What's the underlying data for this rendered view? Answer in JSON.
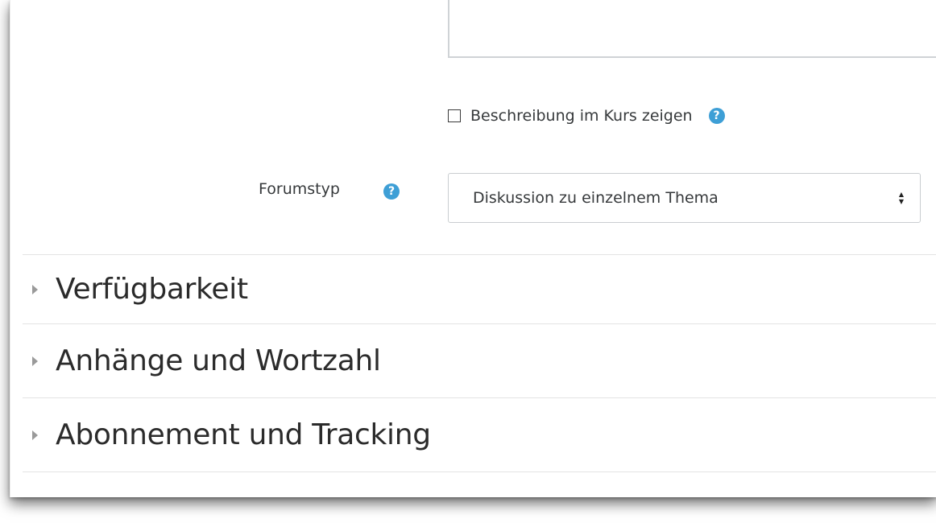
{
  "form": {
    "show_description_label": "Beschreibung im Kurs zeigen",
    "show_description_checked": false,
    "forum_type_label": "Forumstyp",
    "forum_type_value": "Diskussion zu einzelnem Thema",
    "help_glyph": "?",
    "select_arrow_up": "▲",
    "select_arrow_down": "▼"
  },
  "sections": [
    {
      "title": "Verfügbarkeit",
      "expanded": false
    },
    {
      "title": "Anhänge und Wortzahl",
      "expanded": false
    },
    {
      "title": "Abonnement und Tracking",
      "expanded": false
    }
  ],
  "colors": {
    "help_icon": "#3e9fd6",
    "text": "#373a3c",
    "divider": "#e3e3e3"
  },
  "icons": [
    "help-icon",
    "chevron-right-icon",
    "select-arrows-icon"
  ]
}
